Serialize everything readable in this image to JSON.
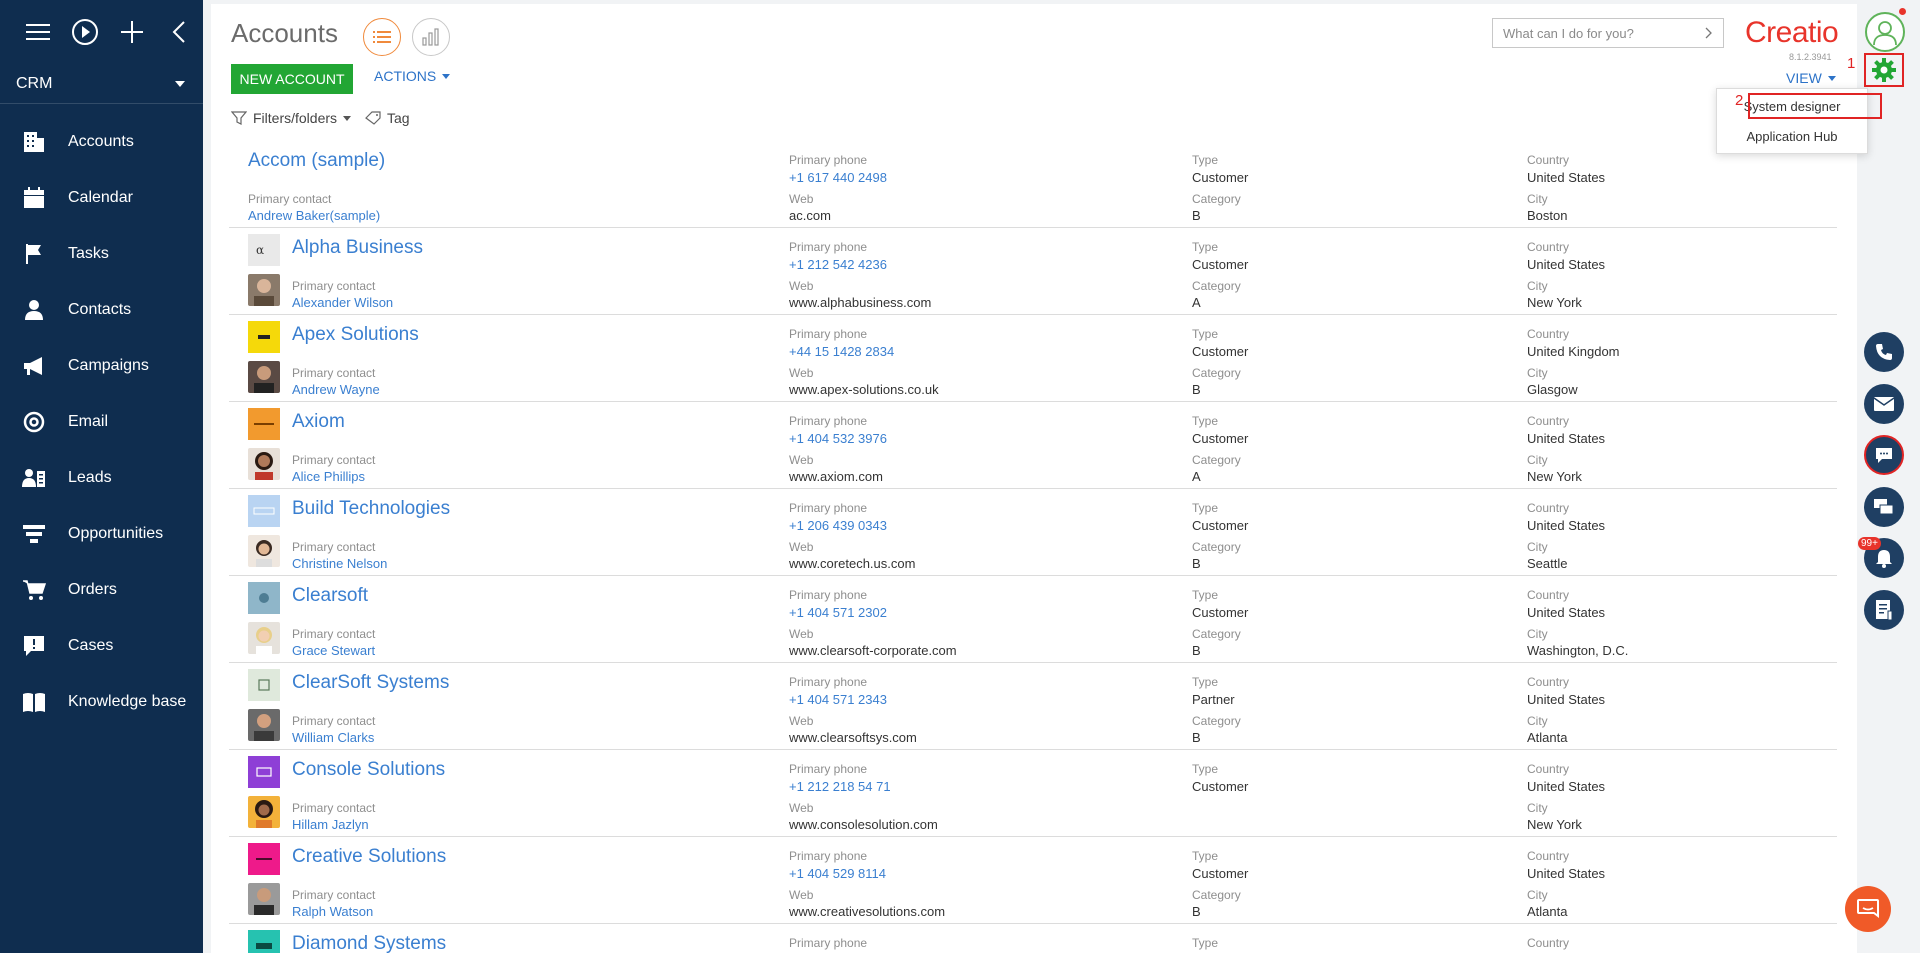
{
  "sidebar": {
    "workplace": "CRM",
    "items": [
      {
        "label": "Accounts",
        "icon": "building-icon"
      },
      {
        "label": "Calendar",
        "icon": "calendar-icon"
      },
      {
        "label": "Tasks",
        "icon": "flag-icon"
      },
      {
        "label": "Contacts",
        "icon": "person-icon"
      },
      {
        "label": "Campaigns",
        "icon": "megaphone-icon"
      },
      {
        "label": "Email",
        "icon": "at-icon"
      },
      {
        "label": "Leads",
        "icon": "leads-icon"
      },
      {
        "label": "Opportunities",
        "icon": "funnel-icon"
      },
      {
        "label": "Orders",
        "icon": "cart-icon"
      },
      {
        "label": "Cases",
        "icon": "case-icon"
      },
      {
        "label": "Knowledge base",
        "icon": "book-icon"
      }
    ]
  },
  "header": {
    "title": "Accounts",
    "new_button": "NEW ACCOUNT",
    "actions": "ACTIONS",
    "filters": "Filters/folders",
    "tag": "Tag",
    "view": "VIEW",
    "search_placeholder": "What can I do for you?",
    "logo": "Creatio",
    "version": "8.1.2.3941"
  },
  "labels": {
    "primary_phone": "Primary phone",
    "web": "Web",
    "type": "Type",
    "category": "Category",
    "country": "Country",
    "city": "City",
    "primary_contact": "Primary contact"
  },
  "accounts": [
    {
      "name": "Accom (sample)",
      "contact": "Andrew Baker(sample)",
      "phone": "+1 617 440 2498",
      "web": "ac.com",
      "type": "Customer",
      "category": "B",
      "country": "United States",
      "city": "Boston"
    },
    {
      "name": "Alpha Business",
      "contact": "Alexander Wilson",
      "phone": "+1 212 542 4236",
      "web": "www.alphabusiness.com",
      "type": "Customer",
      "category": "A",
      "country": "United States",
      "city": "New York"
    },
    {
      "name": "Apex Solutions",
      "contact": "Andrew Wayne",
      "phone": "+44 15 1428 2834",
      "web": "www.apex-solutions.co.uk",
      "type": "Customer",
      "category": "B",
      "country": "United Kingdom",
      "city": "Glasgow"
    },
    {
      "name": "Axiom",
      "contact": "Alice Phillips",
      "phone": "+1 404 532 3976",
      "web": "www.axiom.com",
      "type": "Customer",
      "category": "A",
      "country": "United States",
      "city": "New York"
    },
    {
      "name": "Build Technologies",
      "contact": "Christine Nelson",
      "phone": "+1 206 439 0343",
      "web": "www.coretech.us.com",
      "type": "Customer",
      "category": "B",
      "country": "United States",
      "city": "Seattle"
    },
    {
      "name": "Clearsoft",
      "contact": "Grace Stewart",
      "phone": "+1 404 571 2302",
      "web": "www.clearsoft-corporate.com",
      "type": "Customer",
      "category": "B",
      "country": "United States",
      "city": "Washington, D.C."
    },
    {
      "name": "ClearSoft Systems",
      "contact": "William Clarks",
      "phone": "+1 404 571 2343",
      "web": "www.clearsoftsys.com",
      "type": "Partner",
      "category": "B",
      "country": "United States",
      "city": "Atlanta"
    },
    {
      "name": "Console Solutions",
      "contact": "Hillam Jazlyn",
      "phone": "+1 212 218 54 71",
      "web": "www.consolesolution.com",
      "type": "Customer",
      "category": "",
      "country": "United States",
      "city": "New York"
    },
    {
      "name": "Creative Solutions",
      "contact": "Ralph Watson",
      "phone": "+1 404 529 8114",
      "web": "www.creativesolutions.com",
      "type": "Customer",
      "category": "B",
      "country": "United States",
      "city": "Atlanta"
    },
    {
      "name": "Diamond Systems",
      "contact": "",
      "phone": "",
      "web": "",
      "type": "",
      "category": "",
      "country": "",
      "city": ""
    }
  ],
  "dropdown": {
    "item1": "System designer",
    "item2": "Application Hub",
    "mark1": "1",
    "mark2": "2"
  },
  "rail": {
    "badge": "99+"
  },
  "colors": {
    "sidebar_bg": "#0f2d4f",
    "accent_green": "#22a634",
    "link_blue": "#3a7fd0",
    "highlight_red": "#e02424",
    "logo_red": "#e8342b"
  }
}
